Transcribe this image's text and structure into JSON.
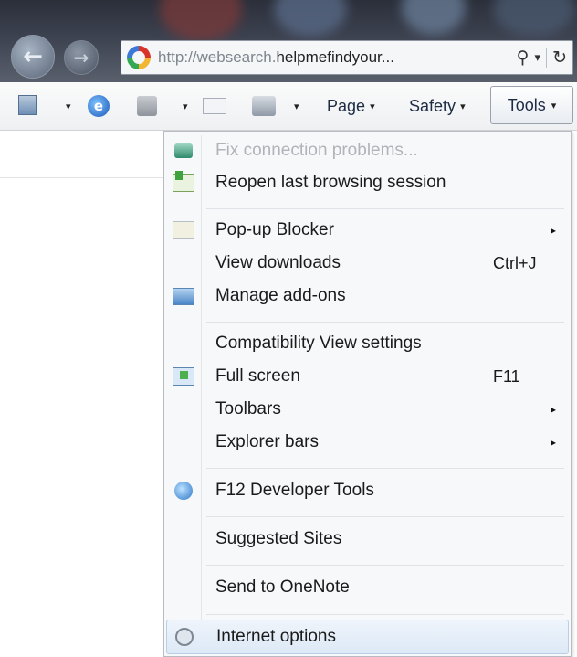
{
  "browser": {
    "address": {
      "url_prefix": "http://websearch.",
      "url_domain": "helpmefindyour...",
      "search_glyph": "⚲",
      "dropdown_glyph": "▾",
      "refresh_glyph": "↻"
    },
    "nav": {
      "back_glyph": "←",
      "forward_glyph": "→"
    }
  },
  "command_bar": {
    "page_label": "Page",
    "safety_label": "Safety",
    "tools_label": "Tools",
    "dropdown_glyph": "▾",
    "ie_glyph": "e"
  },
  "tools_menu": {
    "items": [
      {
        "label": "Fix connection problems...",
        "icon": "network-icon",
        "disabled": true
      },
      {
        "label": "Reopen last browsing session",
        "icon": "reopen-session-icon"
      },
      {
        "label": "Pop-up Blocker",
        "icon": "popup-blocker-icon",
        "submenu": "▸"
      },
      {
        "label": "View downloads",
        "shortcut": "Ctrl+J"
      },
      {
        "label": "Manage add-ons",
        "icon": "addons-icon"
      },
      {
        "label": "Compatibility View settings"
      },
      {
        "label": "Full screen",
        "icon": "full-screen-icon",
        "shortcut": "F11"
      },
      {
        "label": "Toolbars",
        "submenu": "▸"
      },
      {
        "label": "Explorer bars",
        "submenu": "▸"
      },
      {
        "label": "F12 Developer Tools",
        "icon": "developer-tools-icon"
      },
      {
        "label": "Suggested Sites"
      },
      {
        "label": "Send to OneNote"
      },
      {
        "label": "Internet options",
        "icon": "internet-options-icon",
        "highlighted": true
      }
    ]
  }
}
